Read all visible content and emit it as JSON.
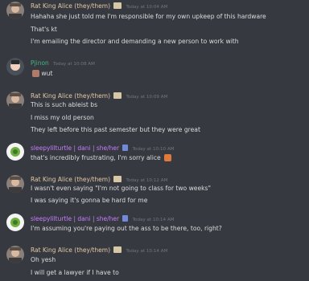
{
  "colors": {
    "background": "#36393f",
    "rat_name": "#e3c9a8",
    "pjinon_name": "#43b581",
    "turtle_name": "#c77dff",
    "timestamp": "#72767d",
    "text": "#dcddde"
  },
  "messages": [
    {
      "author": "Rat King Alice (they/them)",
      "timestamp": "Today at 10:04 AM",
      "lines": [
        "Hahaha she just told me I'm responsible for my own upkeep of this hardware",
        "That's kt",
        "I'm emailing the director and demanding a new person to work with"
      ]
    },
    {
      "author": "Pjinon",
      "timestamp": "Today at 10:08 AM",
      "lines": [
        "wut"
      ]
    },
    {
      "author": "Rat King Alice (they/them)",
      "timestamp": "Today at 10:09 AM",
      "lines": [
        "This is such ableist bs",
        "I miss my old person",
        "They left before this past semester but they were great"
      ]
    },
    {
      "author": "sleepylilturtle | dani | she/her",
      "timestamp": "Today at 10:10 AM",
      "lines": [
        "that's incredibly frustrating, I'm sorry alice"
      ]
    },
    {
      "author": "Rat King Alice (they/them)",
      "timestamp": "Today at 10:12 AM",
      "lines": [
        "I wasn't even saying \"I'm not going to class for two weeks\"",
        "I was saying it's gonna be hard for me"
      ]
    },
    {
      "author": "sleepylilturtle | dani | she/her",
      "timestamp": "Today at 10:14 AM",
      "lines": [
        "I'm assuming you're paying out the ass to be there, too, right?"
      ]
    },
    {
      "author": "Rat King Alice (they/them)",
      "timestamp": "Today at 10:14 AM",
      "lines": [
        "Oh yesh",
        "I will get a lawyer if I have to"
      ]
    }
  ]
}
